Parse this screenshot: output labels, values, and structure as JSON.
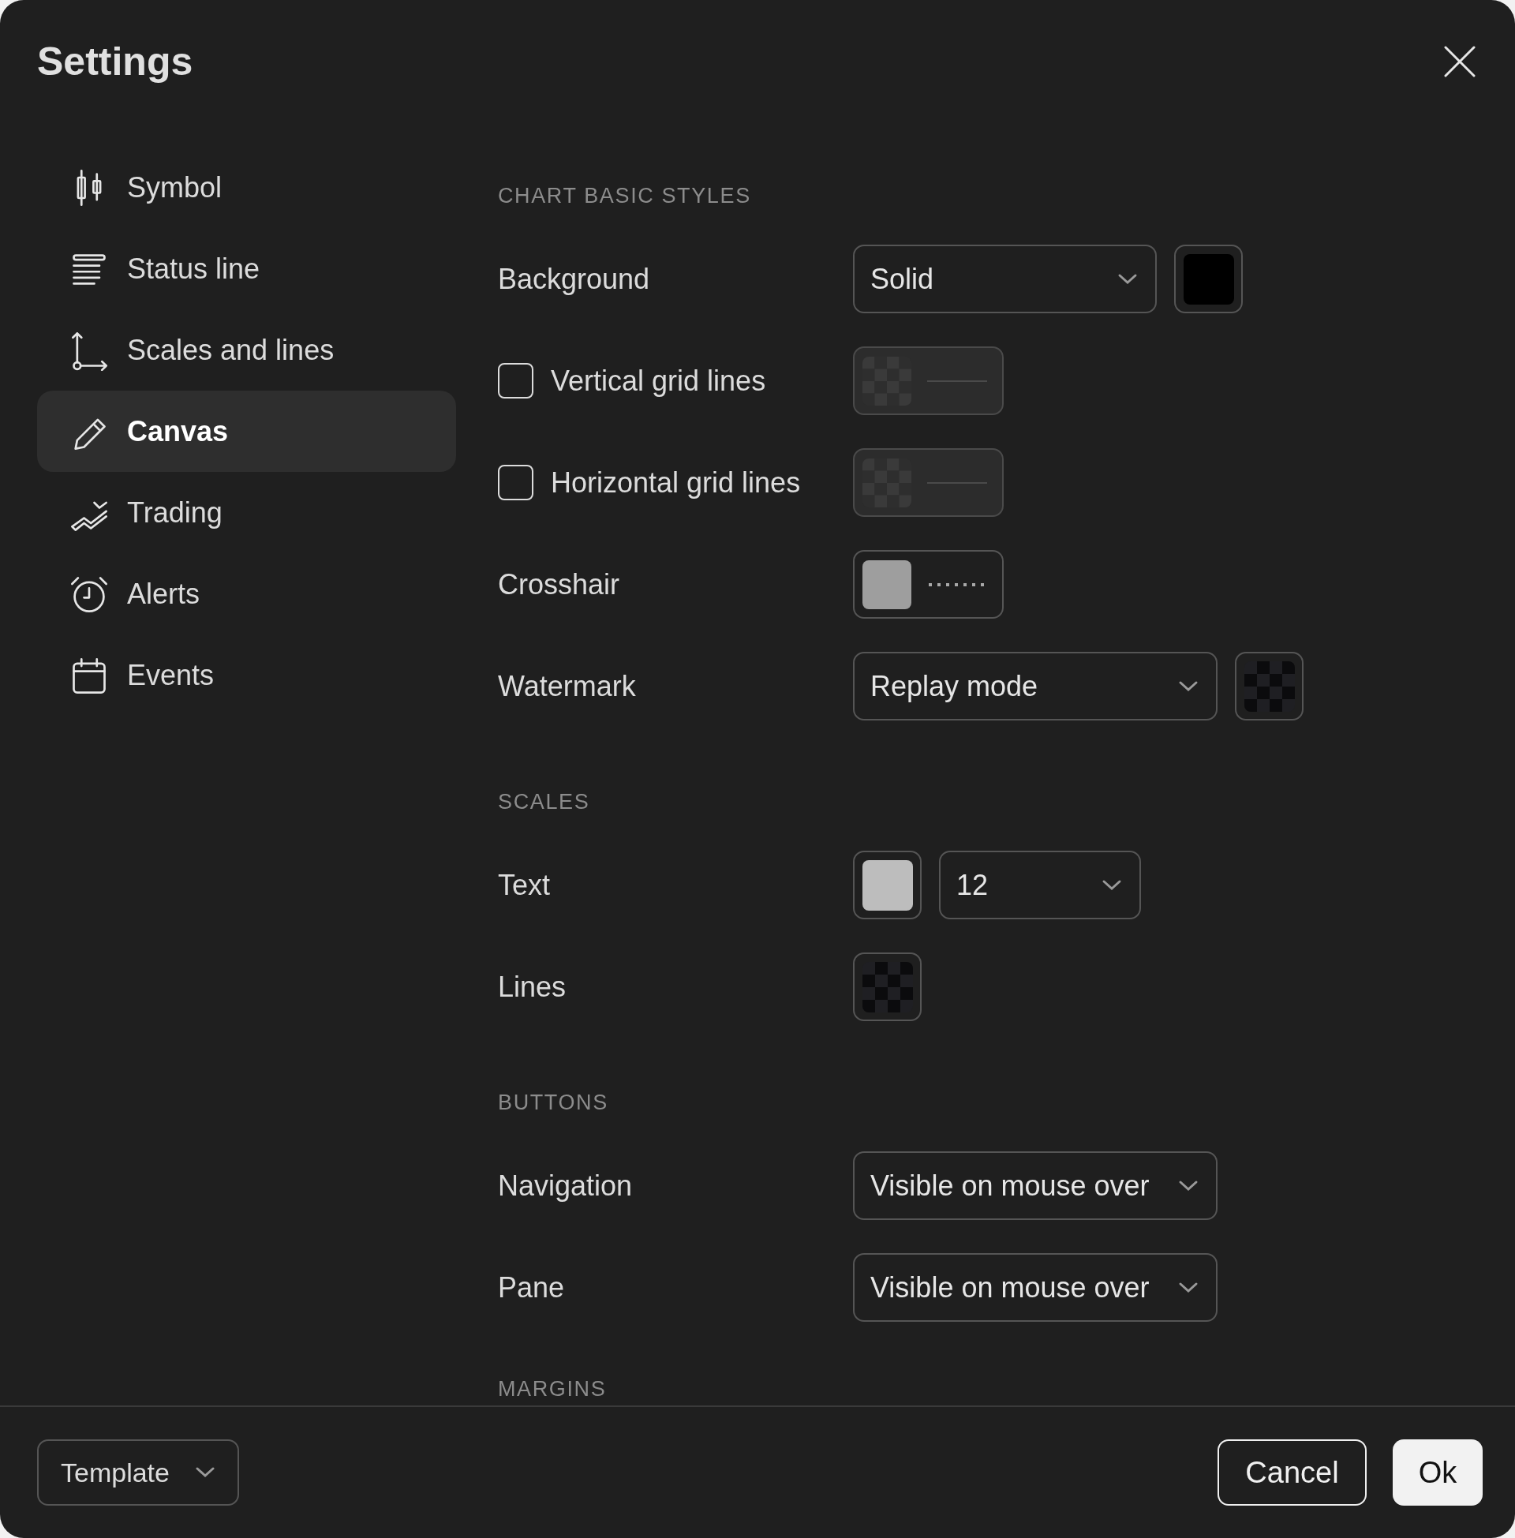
{
  "window": {
    "title": "Settings"
  },
  "sidebar": {
    "items": [
      {
        "label": "Symbol",
        "selected": false
      },
      {
        "label": "Status line",
        "selected": false
      },
      {
        "label": "Scales and lines",
        "selected": false
      },
      {
        "label": "Canvas",
        "selected": true
      },
      {
        "label": "Trading",
        "selected": false
      },
      {
        "label": "Alerts",
        "selected": false
      },
      {
        "label": "Events",
        "selected": false
      }
    ]
  },
  "sections": [
    {
      "title": "CHART BASIC STYLES",
      "rows": [
        {
          "label": "Background",
          "kind": "select",
          "value": "Solid",
          "swatch": {
            "color": "#000000"
          }
        },
        {
          "label": "Vertical grid lines",
          "kind": "checkbox",
          "checked": false,
          "disabled": true,
          "line": {
            "transparent": true
          }
        },
        {
          "label": "Horizontal grid lines",
          "kind": "checkbox",
          "checked": false,
          "disabled": true,
          "line": {
            "transparent": true
          }
        },
        {
          "label": "Crosshair",
          "kind": "line",
          "line": {
            "color": "#9e9e9e"
          }
        },
        {
          "label": "Watermark",
          "kind": "select",
          "value": "Replay mode",
          "swatch": {
            "transparent": true
          }
        }
      ]
    },
    {
      "title": "SCALES",
      "rows": [
        {
          "label": "Text",
          "kind": "color_select",
          "value": "12",
          "swatch": {
            "color": "#bdbdbd"
          }
        },
        {
          "label": "Lines",
          "kind": "color",
          "swatch": {
            "transparent": true
          }
        }
      ]
    },
    {
      "title": "BUTTONS",
      "rows": [
        {
          "label": "Navigation",
          "kind": "select",
          "value": "Visible on mouse over"
        },
        {
          "label": "Pane",
          "kind": "select",
          "value": "Visible on mouse over"
        }
      ]
    },
    {
      "title": "MARGINS"
    }
  ],
  "footer": {
    "template": "Template",
    "cancel": "Cancel",
    "ok": "Ok"
  }
}
